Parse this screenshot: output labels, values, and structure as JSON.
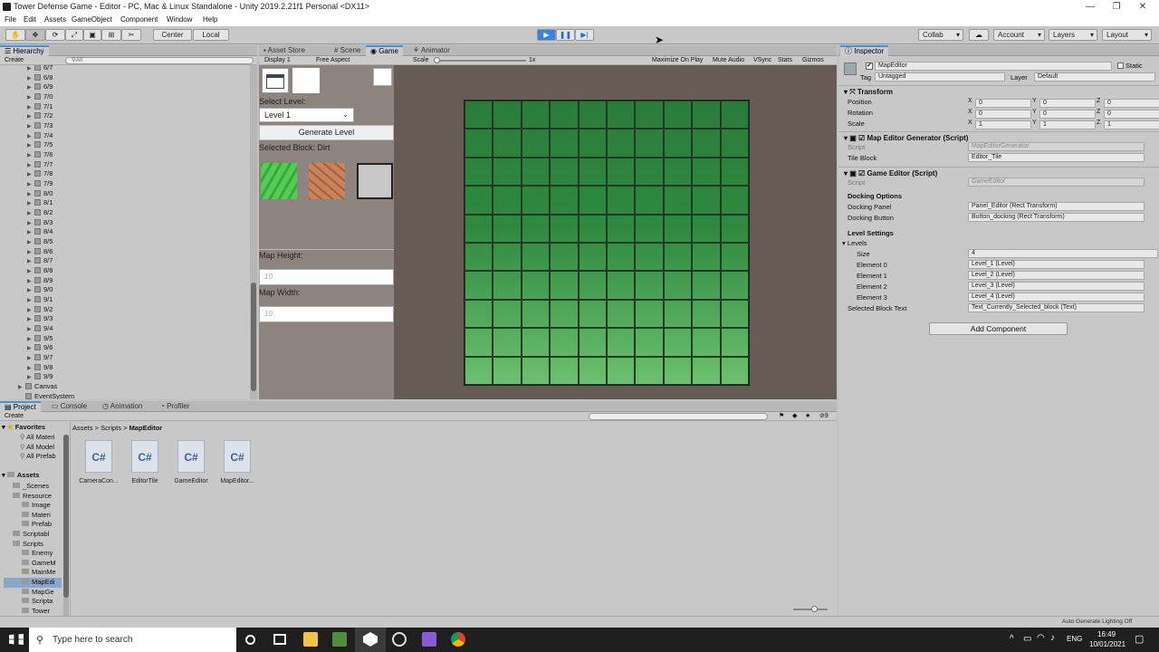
{
  "window": {
    "title": "Tower Defense Game - Editor - PC, Mac & Linux Standalone - Unity 2019.2.21f1 Personal <DX11>",
    "min": "—",
    "max": "❐",
    "close": "✕"
  },
  "menu": [
    "File",
    "Edit",
    "Assets",
    "GameObject",
    "Component",
    "Window",
    "Help"
  ],
  "toolbar": {
    "center": "Center",
    "local": "Local",
    "collab": "Collab",
    "account": "Account",
    "layers": "Layers",
    "layout": "Layout"
  },
  "hierarchy": {
    "tab": "Hierarchy",
    "create": "Create",
    "search": "All",
    "items": [
      "6/7",
      "6/8",
      "6/9",
      "7/0",
      "7/1",
      "7/2",
      "7/3",
      "7/4",
      "7/5",
      "7/6",
      "7/7",
      "7/8",
      "7/9",
      "8/0",
      "8/1",
      "8/2",
      "8/3",
      "8/4",
      "8/5",
      "8/6",
      "8/7",
      "8/8",
      "8/9",
      "9/0",
      "9/1",
      "9/2",
      "9/3",
      "9/4",
      "9/5",
      "9/6",
      "9/7",
      "9/8",
      "9/9"
    ],
    "roots": [
      "Canvas",
      "EventSystem"
    ]
  },
  "tabs_center": {
    "asset_store": "Asset Store",
    "scene": "Scene",
    "game": "Game",
    "animator": "Animator"
  },
  "gamebar": {
    "display": "Display 1",
    "aspect": "Free Aspect",
    "scale": "Scale",
    "scale_val": "1x",
    "maximize": "Maximize On Play",
    "mute": "Mute Audio",
    "vsync": "VSync",
    "stats": "Stats",
    "gizmos": "Gizmos"
  },
  "editor_ui": {
    "select_level": "Select Level:",
    "level_value": "Level 1",
    "generate": "Generate Level",
    "selected_block": "Selected Block: Dirt",
    "map_height": "Map Height:",
    "map_height_ph": "10",
    "map_width": "Map Width:",
    "map_width_ph": "10"
  },
  "grid": {
    "cols": 10,
    "rows": 10
  },
  "inspector": {
    "tab": "Inspector",
    "object_name": "MapEditor",
    "static": "Static",
    "tag_label": "Tag",
    "tag_value": "Untagged",
    "layer_label": "Layer",
    "layer_value": "Default",
    "transform": "Transform",
    "position": "Position",
    "rotation": "Rotation",
    "scale": "Scale",
    "pos": [
      "0",
      "0",
      "0"
    ],
    "rot": [
      "0",
      "0",
      "0"
    ],
    "scl": [
      "1",
      "1",
      "1"
    ],
    "axis": [
      "X",
      "Y",
      "Z"
    ],
    "comp1": "Map Editor Generator (Script)",
    "script_label": "Script",
    "comp1_script": "MapEditorGenerator",
    "tile_block_label": "Tile Block",
    "tile_block": "Editor_Tile",
    "comp2": "Game Editor (Script)",
    "comp2_script": "GameEditor",
    "docking_options": "Docking Options",
    "docking_panel_label": "Docking Panel",
    "docking_panel": "Panel_Editor (Rect Transform)",
    "docking_button_label": "Docking Button",
    "docking_button": "Button_docking (Rect Transform)",
    "level_settings": "Level Settings",
    "levels": "Levels",
    "size_label": "Size",
    "size": "4",
    "elements": [
      {
        "label": "Element 0",
        "value": "Level_1 (Level)"
      },
      {
        "label": "Element 1",
        "value": "Level_2 (Level)"
      },
      {
        "label": "Element 2",
        "value": "Level_3 (Level)"
      },
      {
        "label": "Element 3",
        "value": "Level_4 (Level)"
      }
    ],
    "selected_text_label": "Selected Block Text",
    "selected_text": "Text_Currently_Selected_block (Text)",
    "add_component": "Add Component"
  },
  "bottom_tabs": {
    "project": "Project",
    "console": "Console",
    "animation": "Animation",
    "profiler": "Profiler",
    "create": "Create",
    "count": "9"
  },
  "project": {
    "breadcrumb": [
      "Assets",
      "Scripts",
      "MapEditor"
    ],
    "favorites": "Favorites",
    "fav_items": [
      "All Materi",
      "All Model",
      "All Prefab"
    ],
    "assets": "Assets",
    "tree": [
      {
        "name": "_Scenes",
        "indent": 1
      },
      {
        "name": "Resource",
        "indent": 1
      },
      {
        "name": "Image",
        "indent": 2
      },
      {
        "name": "Materi",
        "indent": 2
      },
      {
        "name": "Prefab",
        "indent": 2
      },
      {
        "name": "Scriptabl",
        "indent": 1
      },
      {
        "name": "Scripts",
        "indent": 1
      },
      {
        "name": "Enemy",
        "indent": 2
      },
      {
        "name": "GameM",
        "indent": 2
      },
      {
        "name": "MainMe",
        "indent": 2
      },
      {
        "name": "MapEdi",
        "indent": 2
      },
      {
        "name": "MapGe",
        "indent": 2
      },
      {
        "name": "Scripta",
        "indent": 2
      },
      {
        "name": "Tower",
        "indent": 2
      }
    ],
    "files": [
      "CameraCon...",
      "EditorTile",
      "GameEditor",
      "MapEditor..."
    ],
    "file_icon": "C#"
  },
  "status": {
    "lighting": "Auto Generate Lighting Off"
  },
  "taskbar": {
    "search": "Type here to search",
    "lang": "ENG",
    "time": "16:49",
    "date": "10/01/2021"
  }
}
